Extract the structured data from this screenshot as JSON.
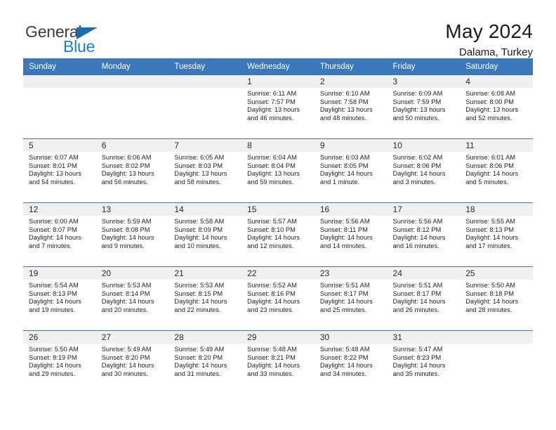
{
  "brand": {
    "name_part1": "General",
    "name_part2": "Blue",
    "accent_color": "#1b7bd0",
    "triangle_color": "#1b6cb5"
  },
  "header": {
    "title": "May 2024",
    "subtitle": "Dalama, Turkey",
    "header_bg": "#3a78ba",
    "daynum_bg": "#f0f0f0"
  },
  "weekday_headers": [
    "Sunday",
    "Monday",
    "Tuesday",
    "Wednesday",
    "Thursday",
    "Friday",
    "Saturday"
  ],
  "weeks": [
    [
      {
        "day": "",
        "empty": true,
        "lines": []
      },
      {
        "day": "",
        "empty": true,
        "lines": []
      },
      {
        "day": "",
        "empty": true,
        "lines": []
      },
      {
        "day": "1",
        "empty": false,
        "lines": [
          "Sunrise: 6:11 AM",
          "Sunset: 7:57 PM",
          "Daylight: 13 hours",
          "and 46 minutes."
        ]
      },
      {
        "day": "2",
        "empty": false,
        "lines": [
          "Sunrise: 6:10 AM",
          "Sunset: 7:58 PM",
          "Daylight: 13 hours",
          "and 48 minutes."
        ]
      },
      {
        "day": "3",
        "empty": false,
        "lines": [
          "Sunrise: 6:09 AM",
          "Sunset: 7:59 PM",
          "Daylight: 13 hours",
          "and 50 minutes."
        ]
      },
      {
        "day": "4",
        "empty": false,
        "lines": [
          "Sunrise: 6:08 AM",
          "Sunset: 8:00 PM",
          "Daylight: 13 hours",
          "and 52 minutes."
        ]
      }
    ],
    [
      {
        "day": "5",
        "empty": false,
        "lines": [
          "Sunrise: 6:07 AM",
          "Sunset: 8:01 PM",
          "Daylight: 13 hours",
          "and 54 minutes."
        ]
      },
      {
        "day": "6",
        "empty": false,
        "lines": [
          "Sunrise: 6:06 AM",
          "Sunset: 8:02 PM",
          "Daylight: 13 hours",
          "and 56 minutes."
        ]
      },
      {
        "day": "7",
        "empty": false,
        "lines": [
          "Sunrise: 6:05 AM",
          "Sunset: 8:03 PM",
          "Daylight: 13 hours",
          "and 58 minutes."
        ]
      },
      {
        "day": "8",
        "empty": false,
        "lines": [
          "Sunrise: 6:04 AM",
          "Sunset: 8:04 PM",
          "Daylight: 13 hours",
          "and 59 minutes."
        ]
      },
      {
        "day": "9",
        "empty": false,
        "lines": [
          "Sunrise: 6:03 AM",
          "Sunset: 8:05 PM",
          "Daylight: 14 hours",
          "and 1 minute."
        ]
      },
      {
        "day": "10",
        "empty": false,
        "lines": [
          "Sunrise: 6:02 AM",
          "Sunset: 8:06 PM",
          "Daylight: 14 hours",
          "and 3 minutes."
        ]
      },
      {
        "day": "11",
        "empty": false,
        "lines": [
          "Sunrise: 6:01 AM",
          "Sunset: 8:06 PM",
          "Daylight: 14 hours",
          "and 5 minutes."
        ]
      }
    ],
    [
      {
        "day": "12",
        "empty": false,
        "lines": [
          "Sunrise: 6:00 AM",
          "Sunset: 8:07 PM",
          "Daylight: 14 hours",
          "and 7 minutes."
        ]
      },
      {
        "day": "13",
        "empty": false,
        "lines": [
          "Sunrise: 5:59 AM",
          "Sunset: 8:08 PM",
          "Daylight: 14 hours",
          "and 9 minutes."
        ]
      },
      {
        "day": "14",
        "empty": false,
        "lines": [
          "Sunrise: 5:58 AM",
          "Sunset: 8:09 PM",
          "Daylight: 14 hours",
          "and 10 minutes."
        ]
      },
      {
        "day": "15",
        "empty": false,
        "lines": [
          "Sunrise: 5:57 AM",
          "Sunset: 8:10 PM",
          "Daylight: 14 hours",
          "and 12 minutes."
        ]
      },
      {
        "day": "16",
        "empty": false,
        "lines": [
          "Sunrise: 5:56 AM",
          "Sunset: 8:11 PM",
          "Daylight: 14 hours",
          "and 14 minutes."
        ]
      },
      {
        "day": "17",
        "empty": false,
        "lines": [
          "Sunrise: 5:56 AM",
          "Sunset: 8:12 PM",
          "Daylight: 14 hours",
          "and 16 minutes."
        ]
      },
      {
        "day": "18",
        "empty": false,
        "lines": [
          "Sunrise: 5:55 AM",
          "Sunset: 8:13 PM",
          "Daylight: 14 hours",
          "and 17 minutes."
        ]
      }
    ],
    [
      {
        "day": "19",
        "empty": false,
        "lines": [
          "Sunrise: 5:54 AM",
          "Sunset: 8:13 PM",
          "Daylight: 14 hours",
          "and 19 minutes."
        ]
      },
      {
        "day": "20",
        "empty": false,
        "lines": [
          "Sunrise: 5:53 AM",
          "Sunset: 8:14 PM",
          "Daylight: 14 hours",
          "and 20 minutes."
        ]
      },
      {
        "day": "21",
        "empty": false,
        "lines": [
          "Sunrise: 5:53 AM",
          "Sunset: 8:15 PM",
          "Daylight: 14 hours",
          "and 22 minutes."
        ]
      },
      {
        "day": "22",
        "empty": false,
        "lines": [
          "Sunrise: 5:52 AM",
          "Sunset: 8:16 PM",
          "Daylight: 14 hours",
          "and 23 minutes."
        ]
      },
      {
        "day": "23",
        "empty": false,
        "lines": [
          "Sunrise: 5:51 AM",
          "Sunset: 8:17 PM",
          "Daylight: 14 hours",
          "and 25 minutes."
        ]
      },
      {
        "day": "24",
        "empty": false,
        "lines": [
          "Sunrise: 5:51 AM",
          "Sunset: 8:17 PM",
          "Daylight: 14 hours",
          "and 26 minutes."
        ]
      },
      {
        "day": "25",
        "empty": false,
        "lines": [
          "Sunrise: 5:50 AM",
          "Sunset: 8:18 PM",
          "Daylight: 14 hours",
          "and 28 minutes."
        ]
      }
    ],
    [
      {
        "day": "26",
        "empty": false,
        "lines": [
          "Sunrise: 5:50 AM",
          "Sunset: 8:19 PM",
          "Daylight: 14 hours",
          "and 29 minutes."
        ]
      },
      {
        "day": "27",
        "empty": false,
        "lines": [
          "Sunrise: 5:49 AM",
          "Sunset: 8:20 PM",
          "Daylight: 14 hours",
          "and 30 minutes."
        ]
      },
      {
        "day": "28",
        "empty": false,
        "lines": [
          "Sunrise: 5:49 AM",
          "Sunset: 8:20 PM",
          "Daylight: 14 hours",
          "and 31 minutes."
        ]
      },
      {
        "day": "29",
        "empty": false,
        "lines": [
          "Sunrise: 5:48 AM",
          "Sunset: 8:21 PM",
          "Daylight: 14 hours",
          "and 33 minutes."
        ]
      },
      {
        "day": "30",
        "empty": false,
        "lines": [
          "Sunrise: 5:48 AM",
          "Sunset: 8:22 PM",
          "Daylight: 14 hours",
          "and 34 minutes."
        ]
      },
      {
        "day": "31",
        "empty": false,
        "lines": [
          "Sunrise: 5:47 AM",
          "Sunset: 8:23 PM",
          "Daylight: 14 hours",
          "and 35 minutes."
        ]
      },
      {
        "day": "",
        "empty": true,
        "lines": []
      }
    ]
  ]
}
